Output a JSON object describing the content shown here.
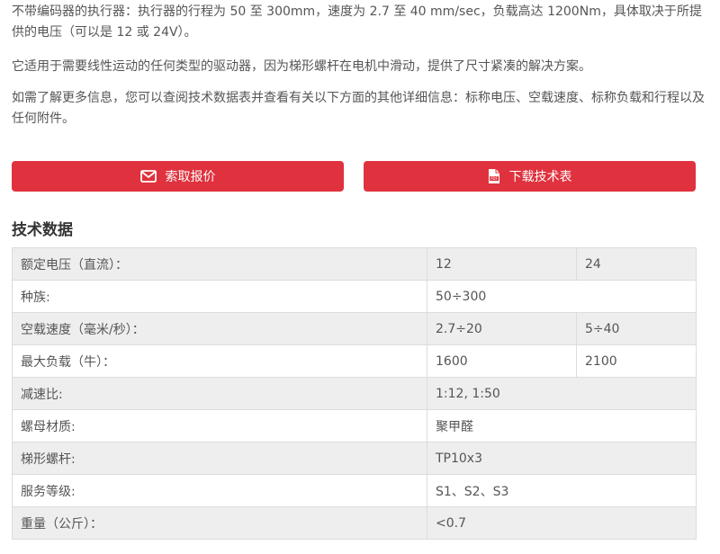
{
  "description": {
    "p1": "不带编码器的执行器：执行器的行程为 50 至 300mm，速度为 2.7 至 40 mm/sec，负载高达 1200Nm，具体取决于所提供的电压（可以是 12 或 24V）。",
    "p2": "它适用于需要线性运动的任何类型的驱动器，因为梯形螺杆在电机中滑动，提供了尺寸紧凑的解决方案。",
    "p3": "如需了解更多信息，您可以查阅技术数据表并查看有关以下方面的其他详细信息：标称电压、空载速度、标称负载和行程以及任何附件。"
  },
  "buttons": {
    "quote": {
      "label": "索取报价",
      "icon": "envelope-icon"
    },
    "datasheet": {
      "label": "下载技术表",
      "icon": "pdf-file-icon"
    }
  },
  "colors": {
    "accent": "#e0323e",
    "row_alt": "#eeeeee",
    "border": "#dcdcdc",
    "text": "#555555"
  },
  "tech_data": {
    "title": "技术数据",
    "rows": [
      {
        "label": "额定电压（直流）：",
        "values": [
          "12",
          "24"
        ]
      },
      {
        "label": "种族:",
        "values": [
          "50÷300"
        ]
      },
      {
        "label": "空载速度（毫米/秒）：",
        "values": [
          "2.7÷20",
          "5÷40"
        ]
      },
      {
        "label": "最大负载（牛）：",
        "values": [
          "1600",
          "2100"
        ]
      },
      {
        "label": "减速比:",
        "values": [
          "1:12, 1:50"
        ]
      },
      {
        "label": "螺母材质:",
        "values": [
          "聚甲醛"
        ]
      },
      {
        "label": "梯形螺杆:",
        "values": [
          "TP10x3"
        ]
      },
      {
        "label": "服务等级:",
        "values": [
          "S1、S2、S3"
        ]
      },
      {
        "label": "重量（公斤）：",
        "values": [
          "<0.7"
        ]
      }
    ]
  }
}
